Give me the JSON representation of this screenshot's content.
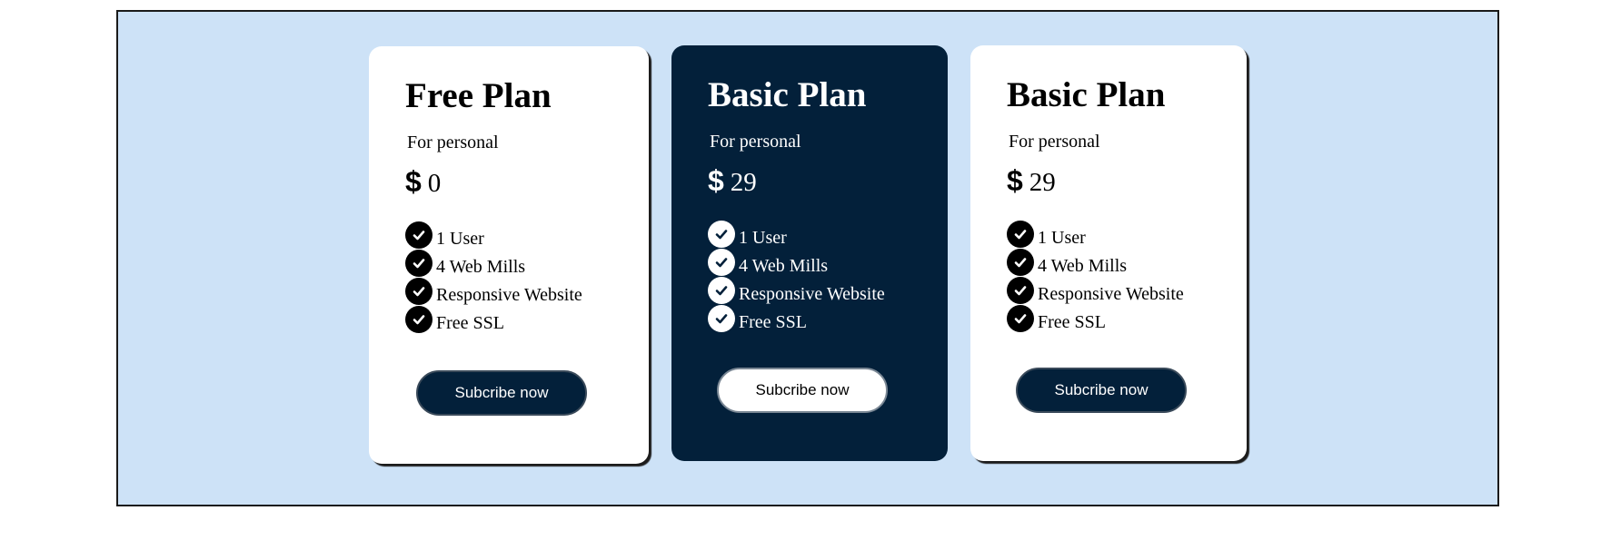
{
  "plans": [
    {
      "title": "Free Plan",
      "subtitle": "For personal",
      "currency_symbol": "$",
      "price": "0",
      "features": [
        "1 User",
        "4 Web Mills",
        "Responsive Website",
        "Free SSL"
      ],
      "button_label": "Subcribe now",
      "theme": "light"
    },
    {
      "title": "Basic Plan",
      "subtitle": "For personal",
      "currency_symbol": "$",
      "price": "29",
      "features": [
        "1 User",
        "4 Web Mills",
        "Responsive Website",
        "Free SSL"
      ],
      "button_label": "Subcribe now",
      "theme": "dark"
    },
    {
      "title": "Basic Plan",
      "subtitle": "For personal",
      "currency_symbol": "$",
      "price": "29",
      "features": [
        "1 User",
        "4 Web Mills",
        "Responsive Website",
        "Free SSL"
      ],
      "button_label": "Subcribe now",
      "theme": "light"
    }
  ],
  "icons": {
    "feature_icon": "check-circle-icon",
    "currency_icon": "dollar-icon"
  },
  "colors": {
    "background": "#cde2f7",
    "dark_card": "#03203a",
    "light_card": "#ffffff",
    "button_dark": "#03203a",
    "button_light": "#ffffff"
  }
}
